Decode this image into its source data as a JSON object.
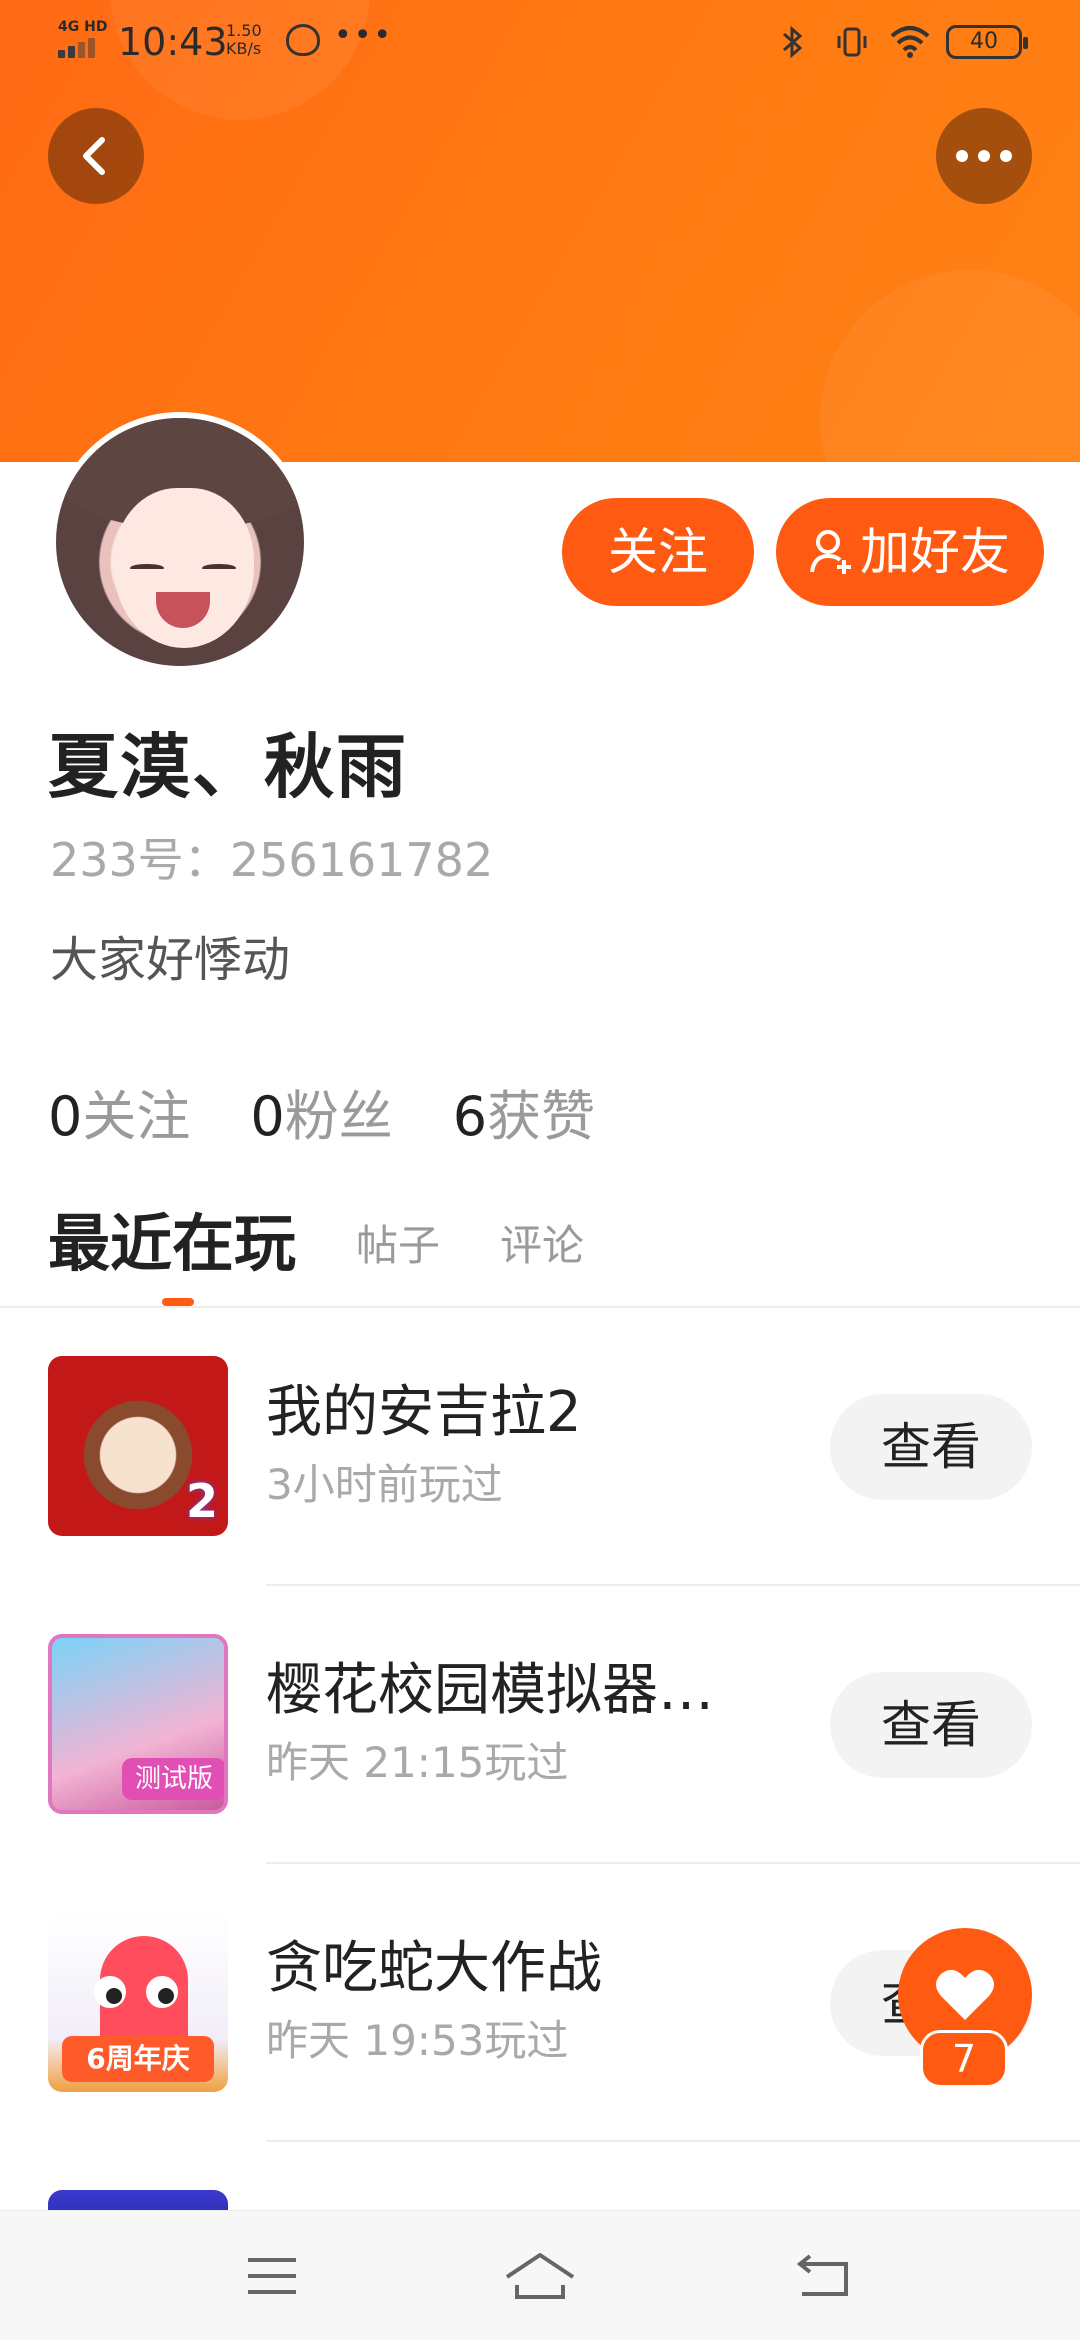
{
  "status_bar": {
    "network": "4G HD",
    "time": "10:43",
    "speed_value": "1.50",
    "speed_unit": "KB/s",
    "more": "•••",
    "battery": "40"
  },
  "profile": {
    "follow_button": "关注",
    "add_friend_button": "加好友",
    "name": "夏漠、秋雨",
    "uid_label": "233号：",
    "uid": "256161782",
    "bio": "大家好悸动"
  },
  "stats": [
    {
      "value": "0",
      "label": "关注"
    },
    {
      "value": "0",
      "label": "粉丝"
    },
    {
      "value": "6",
      "label": "获赞"
    }
  ],
  "tabs": {
    "active": "最近在玩",
    "items": [
      "帖子",
      "评论"
    ]
  },
  "games": [
    {
      "title": "我的安吉拉2",
      "played": "3小时前玩过",
      "view_label": "查看",
      "icon_badge": "2"
    },
    {
      "title": "樱花校园模拟器…",
      "played": "昨天 21:15玩过",
      "view_label": "查看",
      "icon_badge": "测试版"
    },
    {
      "title": "贪吃蛇大作战",
      "played": "昨天 19:53玩过",
      "view_label": "查看",
      "icon_badge": "6周年庆"
    }
  ],
  "like_fab": {
    "count": "7"
  },
  "colors": {
    "accent": "#ff5a12",
    "banner": "#ff7a12"
  },
  "icons": [
    "back-icon",
    "more-icon",
    "user-add-icon",
    "heart-icon",
    "menu-icon",
    "home-icon",
    "return-icon"
  ]
}
